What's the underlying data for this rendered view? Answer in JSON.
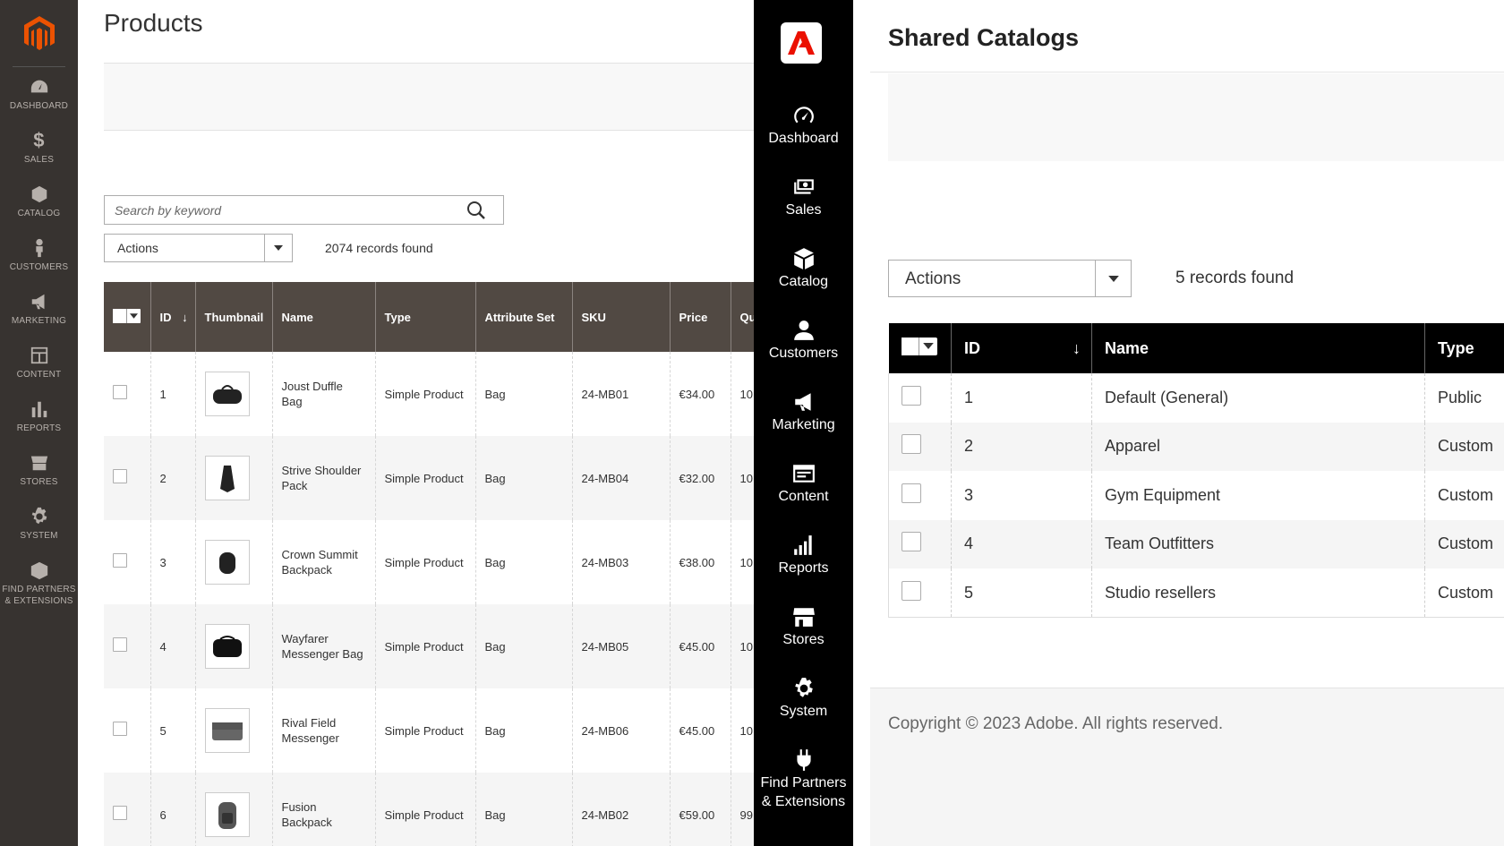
{
  "old_admin": {
    "nav": [
      {
        "label": "DASHBOARD",
        "icon": "dashboard-icon"
      },
      {
        "label": "SALES",
        "icon": "dollar-icon"
      },
      {
        "label": "CATALOG",
        "icon": "box-icon"
      },
      {
        "label": "CUSTOMERS",
        "icon": "person-icon"
      },
      {
        "label": "MARKETING",
        "icon": "megaphone-icon"
      },
      {
        "label": "CONTENT",
        "icon": "layout-icon"
      },
      {
        "label": "REPORTS",
        "icon": "bar-chart-icon"
      },
      {
        "label": "STORES",
        "icon": "store-icon"
      },
      {
        "label": "SYSTEM",
        "icon": "gear-icon"
      },
      {
        "label": "FIND PARTNERS & EXTENSIONS",
        "icon": "package-icon"
      }
    ],
    "page_title": "Products",
    "search_placeholder": "Search by keyword",
    "actions_label": "Actions",
    "records_found": "2074 records found",
    "columns": [
      "ID",
      "Thumbnail",
      "Name",
      "Type",
      "Attribute Set",
      "SKU",
      "Price",
      "Qu"
    ],
    "rows": [
      {
        "id": "1",
        "name": "Joust Duffle Bag",
        "type": "Simple Product",
        "attr": "Bag",
        "sku": "24-MB01",
        "price": "€34.00",
        "qty": "10"
      },
      {
        "id": "2",
        "name": "Strive Shoulder Pack",
        "type": "Simple Product",
        "attr": "Bag",
        "sku": "24-MB04",
        "price": "€32.00",
        "qty": "10"
      },
      {
        "id": "3",
        "name": "Crown Summit Backpack",
        "type": "Simple Product",
        "attr": "Bag",
        "sku": "24-MB03",
        "price": "€38.00",
        "qty": "10"
      },
      {
        "id": "4",
        "name": "Wayfarer Messenger Bag",
        "type": "Simple Product",
        "attr": "Bag",
        "sku": "24-MB05",
        "price": "€45.00",
        "qty": "10"
      },
      {
        "id": "5",
        "name": "Rival Field Messenger",
        "type": "Simple Product",
        "attr": "Bag",
        "sku": "24-MB06",
        "price": "€45.00",
        "qty": "10"
      },
      {
        "id": "6",
        "name": "Fusion Backpack",
        "type": "Simple Product",
        "attr": "Bag",
        "sku": "24-MB02",
        "price": "€59.00",
        "qty": "99"
      }
    ]
  },
  "new_admin": {
    "nav": [
      {
        "label": "Dashboard",
        "icon": "dashboard-icon"
      },
      {
        "label": "Sales",
        "icon": "cash-icon"
      },
      {
        "label": "Catalog",
        "icon": "cube-icon"
      },
      {
        "label": "Customers",
        "icon": "people-icon"
      },
      {
        "label": "Marketing",
        "icon": "megaphone-icon"
      },
      {
        "label": "Content",
        "icon": "layout-icon"
      },
      {
        "label": "Reports",
        "icon": "bar-chart-icon"
      },
      {
        "label": "Stores",
        "icon": "store-icon"
      },
      {
        "label": "System",
        "icon": "gear-icon"
      },
      {
        "label": "Find Partners & Extensions",
        "icon": "plug-icon"
      }
    ],
    "page_title": "Shared Catalogs",
    "actions_label": "Actions",
    "records_found": "5 records found",
    "columns": [
      "ID",
      "Name",
      "Type"
    ],
    "rows": [
      {
        "id": "1",
        "name": "Default (General)",
        "type": "Public"
      },
      {
        "id": "2",
        "name": "Apparel",
        "type": "Custom"
      },
      {
        "id": "3",
        "name": "Gym Equipment",
        "type": "Custom"
      },
      {
        "id": "4",
        "name": "Team Outfitters",
        "type": "Custom"
      },
      {
        "id": "5",
        "name": "Studio resellers",
        "type": "Custom"
      }
    ],
    "copyright": "Copyright © 2023 Adobe. All rights reserved."
  },
  "colors": {
    "old_header": "#514943",
    "old_sidebar": "#373330",
    "new_sidebar": "#000000",
    "magento_orange": "#eb5202",
    "adobe_red": "#eb1000"
  }
}
